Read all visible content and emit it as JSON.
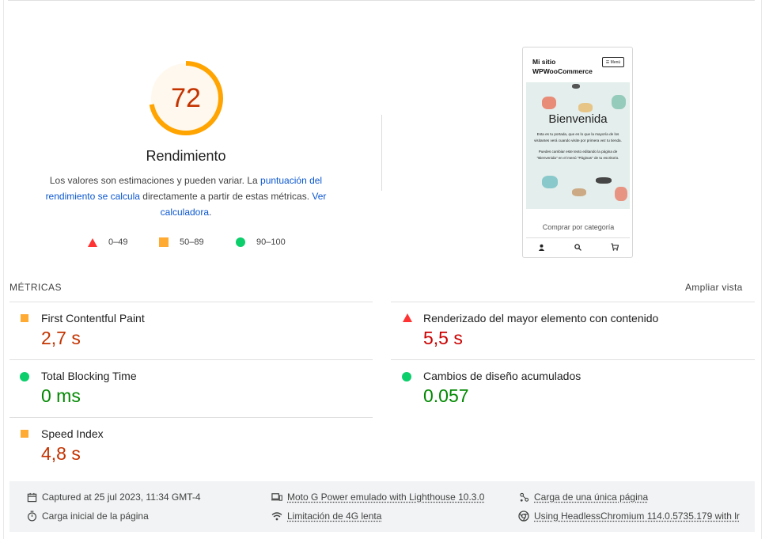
{
  "score": {
    "value": "72",
    "fraction": 0.72,
    "title": "Rendimiento",
    "desc_prefix": "Los valores son estimaciones y pueden variar. La ",
    "desc_link1": "puntuación del rendimiento se calcula",
    "desc_middle": " directamente a partir de estas métricas. ",
    "desc_link2": "Ver calculadora",
    "desc_suffix": ".",
    "color": "#ffa400"
  },
  "legend": [
    {
      "label": "0–49",
      "color": "#ff3333"
    },
    {
      "label": "50–89",
      "color": "#ffaa33"
    },
    {
      "label": "90–100",
      "color": "#0cce6b"
    }
  ],
  "screenshot": {
    "site_title": "Mi sitio WPWooCommerce",
    "menu_label": "☰ Menú",
    "hero_title": "Bienvenida",
    "hero_text1": "Esta es tu portada, que es lo que la mayoría de los visitantes verá cuando visite por primera vez tu tienda.",
    "hero_text2": "Puedes cambiar este texto editando la página de \"Bienvenida\" en el menú \"Páginas\" de tu escritorio.",
    "category_label": "Comprar por categoría"
  },
  "metrics": {
    "title": "MÉTRICAS",
    "expand": "Ampliar vista",
    "items": [
      {
        "name": "First Contentful Paint",
        "value": "2,7 s",
        "status": "average"
      },
      {
        "name": "Renderizado del mayor elemento con contenido",
        "value": "5,5 s",
        "status": "fail"
      },
      {
        "name": "Total Blocking Time",
        "value": "0 ms",
        "status": "pass"
      },
      {
        "name": "Cambios de diseño acumulados",
        "value": "0.057",
        "status": "pass"
      },
      {
        "name": "Speed Index",
        "value": "4,8 s",
        "status": "average"
      }
    ]
  },
  "footer": {
    "captured": "Captured at 25 jul 2023, 11:34 GMT-4",
    "device": "Moto G Power emulado with Lighthouse 10.3.0",
    "single_load": "Carga de una única página",
    "initial_load": "Carga inicial de la página",
    "throttling": "Limitación de 4G lenta",
    "browser": "Using HeadlessChromium 114.0.5735.179 with lr"
  }
}
